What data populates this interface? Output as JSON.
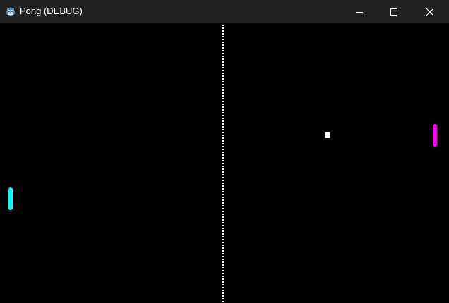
{
  "window": {
    "title": "Pong (DEBUG)",
    "app_icon": "godot-engine-icon",
    "controls": {
      "minimize": "minimize-icon",
      "maximize": "maximize-icon",
      "close": "close-icon"
    }
  },
  "game": {
    "background_color": "#000000",
    "net_color": "#ffffff",
    "left_paddle": {
      "color": "#00ffff"
    },
    "right_paddle": {
      "color": "#ff00ff"
    },
    "ball": {
      "color": "#ffffff"
    }
  }
}
